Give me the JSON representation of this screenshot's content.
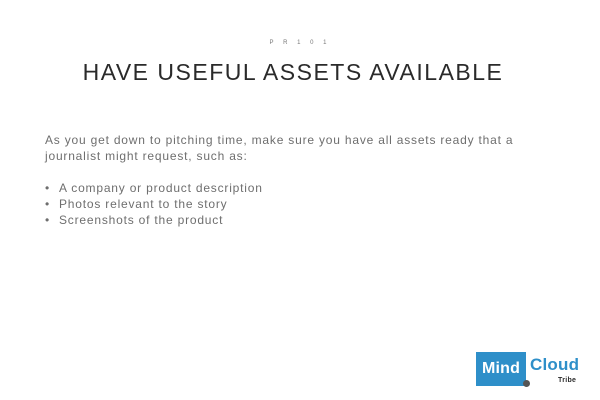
{
  "slide": {
    "eyebrow": "P R  1 0 1",
    "title": "HAVE USEFUL ASSETS AVAILABLE",
    "intro": "As you get down to pitching time, make sure you have all assets ready that a journalist might request, such as:",
    "bullet_symbol": "•",
    "bullets": [
      "A company or product description",
      "Photos relevant to the story",
      "Screenshots of the product"
    ]
  },
  "logo": {
    "mind": "Mind",
    "cloud": "Cloud",
    "tribe": "Tribe",
    "brand_color": "#2e8fc9"
  }
}
